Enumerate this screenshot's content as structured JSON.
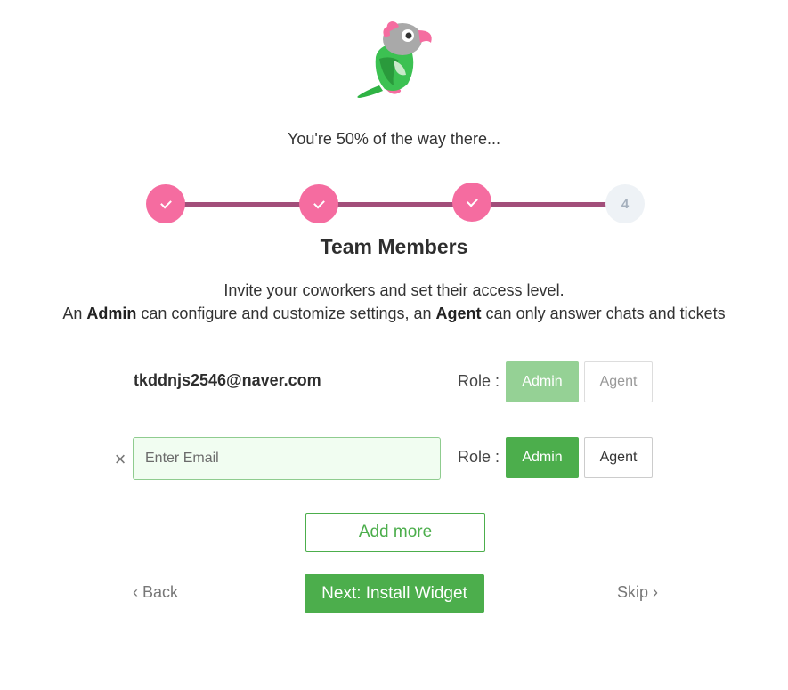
{
  "logo": {
    "icon": "parrot-logo"
  },
  "progress": {
    "text": "You're 50% of the way there...",
    "steps": [
      {
        "state": "done",
        "label": ""
      },
      {
        "state": "done",
        "label": ""
      },
      {
        "state": "done",
        "label": ""
      },
      {
        "state": "pending",
        "label": "4"
      }
    ]
  },
  "title": "Team Members",
  "description": {
    "line1": "Invite your coworkers and set their access level.",
    "line2_prefix": "An ",
    "admin_word": "Admin",
    "line2_middle": " can configure and customize settings, an ",
    "agent_word": "Agent",
    "line2_suffix": " can only answer chats and tickets"
  },
  "existing_member": {
    "email": "tkddnjs2546@naver.com",
    "role_label": "Role :",
    "admin_label": "Admin",
    "agent_label": "Agent"
  },
  "new_member": {
    "email_value": "",
    "email_placeholder": "Enter Email",
    "role_label": "Role :",
    "admin_label": "Admin",
    "agent_label": "Agent",
    "remove_icon": "×"
  },
  "actions": {
    "add_more": "Add more",
    "back": "‹ Back",
    "next": "Next: Install Widget",
    "skip": "Skip ›"
  },
  "colors": {
    "step_done": "#f56ca0",
    "step_line": "#a24e7a",
    "primary_green": "#4cae4c",
    "disabled_green": "#95d195"
  }
}
